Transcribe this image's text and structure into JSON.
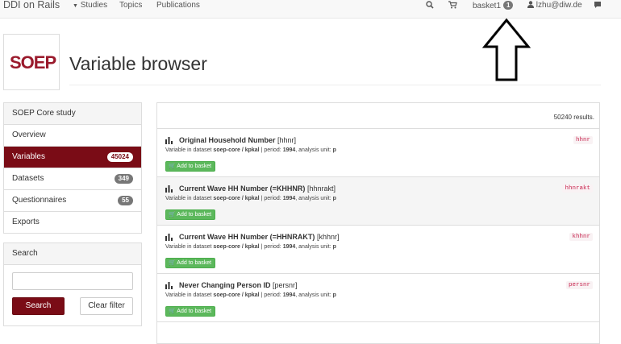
{
  "navbar": {
    "brand": "DDI on Rails",
    "studies_label": "Studies",
    "topics_label": "Topics",
    "publications_label": "Publications",
    "basket_label": "basket1",
    "basket_count": "1",
    "user_label": "lzhu@diw.de"
  },
  "header": {
    "logo_text": "SOEP",
    "title": "Variable browser"
  },
  "sidebar": {
    "heading": "SOEP Core study",
    "items": [
      {
        "label": "Overview",
        "badge": ""
      },
      {
        "label": "Variables",
        "badge": "45024"
      },
      {
        "label": "Datasets",
        "badge": "349"
      },
      {
        "label": "Questionnaires",
        "badge": "55"
      },
      {
        "label": "Exports",
        "badge": ""
      }
    ]
  },
  "search": {
    "heading": "Search",
    "input_value": "",
    "search_button": "Search",
    "clear_button": "Clear filter"
  },
  "results": {
    "count_text": "50240 results.",
    "add_label": "Add to basket",
    "meta_prefix": "Variable in dataset ",
    "meta_period": " | period: ",
    "meta_unit": ", analysis unit: ",
    "items": [
      {
        "label": "Original Household Number",
        "name": "[hhnr]",
        "dataset": "soep-core / kpkal",
        "period": "1994",
        "unit": "p",
        "code": "hhnr"
      },
      {
        "label": "Current Wave HH Number (=KHHNR)",
        "name": "[hhnrakt]",
        "dataset": "soep-core / kpkal",
        "period": "1994",
        "unit": "p",
        "code": "hhnrakt"
      },
      {
        "label": "Current Wave HH Number (=HHNRAKT)",
        "name": "[khhnr]",
        "dataset": "soep-core / kpkal",
        "period": "1994",
        "unit": "p",
        "code": "khhnr"
      },
      {
        "label": "Never Changing Person ID",
        "name": "[persnr]",
        "dataset": "soep-core / kpkal",
        "period": "1994",
        "unit": "p",
        "code": "persnr"
      }
    ]
  }
}
